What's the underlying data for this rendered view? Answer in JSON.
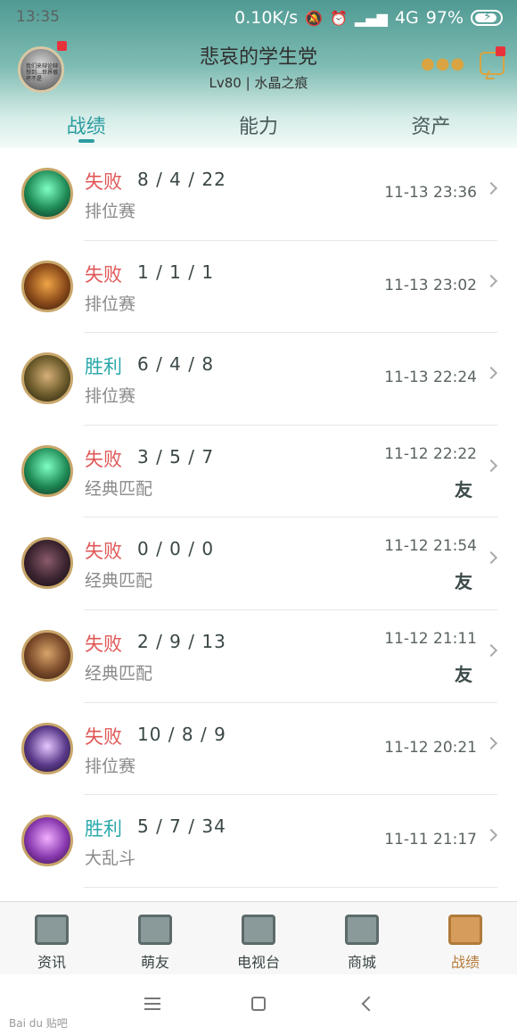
{
  "status_bar": {
    "time": "13:35",
    "network_speed": "0.10K/s",
    "network_type": "4G",
    "battery": "97%"
  },
  "profile": {
    "name": "悲哀的学生党",
    "level_region": "Lv80 | 水晶之痕",
    "avatar_caption": "我们来辩论辩 想到…世界很坏不是"
  },
  "tabs": [
    {
      "label": "战绩",
      "active": true
    },
    {
      "label": "能力",
      "active": false
    },
    {
      "label": "资产",
      "active": false
    }
  ],
  "matches": [
    {
      "result": "失败",
      "outcome": "loss",
      "kda": "8 / 4 / 22",
      "mode": "排位赛",
      "time": "11-13 23:36",
      "friend": "",
      "champion": "thresh"
    },
    {
      "result": "失败",
      "outcome": "loss",
      "kda": "1 / 1 / 1",
      "mode": "排位赛",
      "time": "11-13 23:02",
      "friend": "",
      "champion": "amumu"
    },
    {
      "result": "胜利",
      "outcome": "win",
      "kda": "6 / 4 / 8",
      "mode": "排位赛",
      "time": "11-13 22:24",
      "friend": "",
      "champion": "cassiopeia"
    },
    {
      "result": "失败",
      "outcome": "loss",
      "kda": "3 / 5 / 7",
      "mode": "经典匹配",
      "time": "11-12 22:22",
      "friend": "友",
      "champion": "thresh"
    },
    {
      "result": "失败",
      "outcome": "loss",
      "kda": "0 / 0 / 0",
      "mode": "经典匹配",
      "time": "11-12 21:54",
      "friend": "友",
      "champion": "mordekaiser"
    },
    {
      "result": "失败",
      "outcome": "loss",
      "kda": "2 / 9 / 13",
      "mode": "经典匹配",
      "time": "11-12 21:11",
      "friend": "友",
      "champion": "gragas"
    },
    {
      "result": "失败",
      "outcome": "loss",
      "kda": "10 / 8 / 9",
      "mode": "排位赛",
      "time": "11-12 20:21",
      "friend": "",
      "champion": "leblanc"
    },
    {
      "result": "胜利",
      "outcome": "win",
      "kda": "5 / 7 / 34",
      "mode": "大乱斗",
      "time": "11-11 21:17",
      "friend": "",
      "champion": "lulu"
    }
  ],
  "bottom_nav": [
    {
      "label": "资讯",
      "icon": "news-icon",
      "active": false
    },
    {
      "label": "萌友",
      "icon": "friends-icon",
      "active": false
    },
    {
      "label": "电视台",
      "icon": "tv-icon",
      "active": false
    },
    {
      "label": "商城",
      "icon": "shop-icon",
      "active": false
    },
    {
      "label": "战绩",
      "icon": "record-icon",
      "active": true
    }
  ],
  "watermark": "Bai du 贴吧"
}
